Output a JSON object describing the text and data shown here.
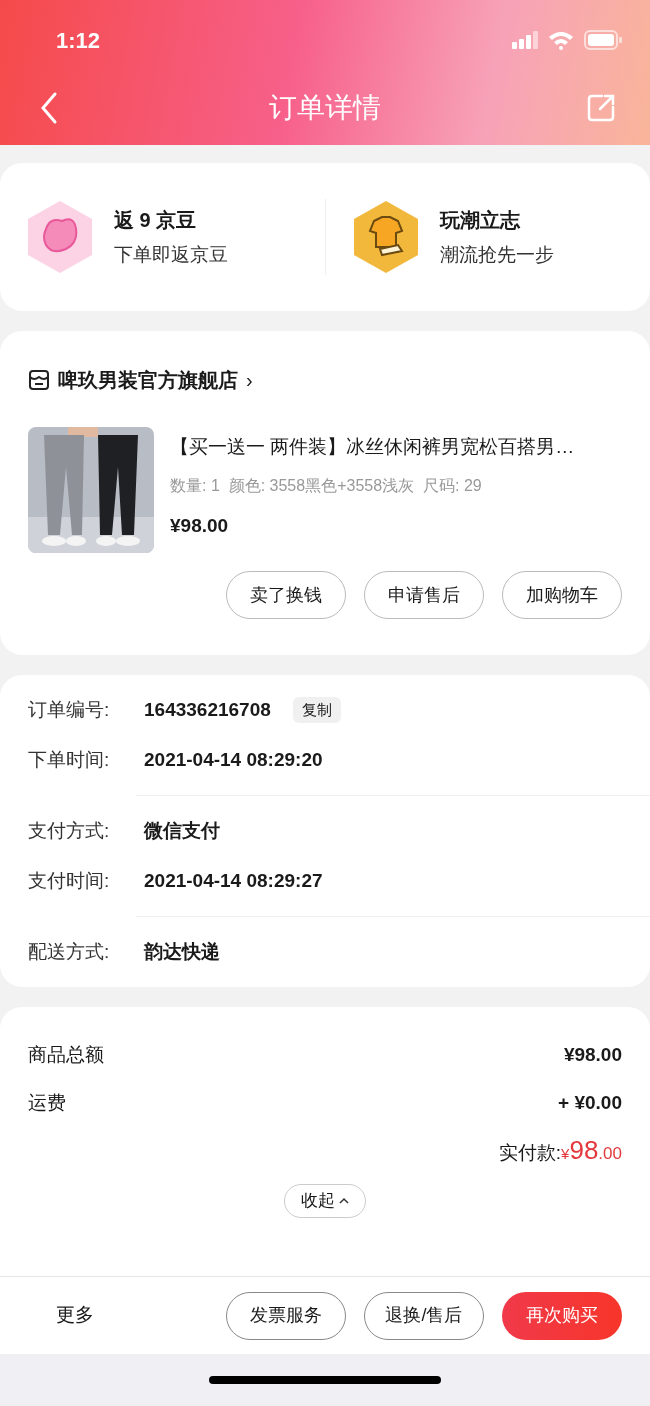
{
  "status_bar": {
    "time": "1:12"
  },
  "header": {
    "title": "订单详情"
  },
  "perks": [
    {
      "kind": "bean",
      "title": "返 9 京豆",
      "subtitle": "下单即返京豆"
    },
    {
      "kind": "trend",
      "title": "玩潮立志",
      "subtitle": "潮流抢先一步"
    }
  ],
  "store": {
    "name": "啤玖男装官方旗舰店",
    "chevron": "›"
  },
  "product": {
    "title": "【买一送一 两件装】冰丝休闲裤男宽松百搭男…",
    "specs": "数量: 1  颜色: 3558黑色+3558浅灰  尺码: 29",
    "price": "¥98.00",
    "actions": [
      "卖了换钱",
      "申请售后",
      "加购物车"
    ]
  },
  "order_info": [
    [
      {
        "label": "订单编号:",
        "value": "164336216708",
        "tag": "复制"
      },
      {
        "label": "下单时间:",
        "value": "2021-04-14 08:29:20"
      }
    ],
    [
      {
        "label": "支付方式:",
        "value": "微信支付"
      },
      {
        "label": "支付时间:",
        "value": "2021-04-14 08:29:27"
      }
    ],
    [
      {
        "label": "配送方式:",
        "value": "韵达快递"
      }
    ]
  ],
  "summary": {
    "rows": [
      {
        "label": "商品总额",
        "value": "¥98.00"
      },
      {
        "label": "运费",
        "value": "+ ¥0.00"
      }
    ],
    "paid_label": "实付款:",
    "paid_currency": "¥",
    "paid_int": "98",
    "paid_dec": ".00",
    "collapse": "收起"
  },
  "bottom_bar": {
    "more": "更多",
    "buttons": [
      {
        "label": "发票服务",
        "primary": false
      },
      {
        "label": "退换/售后",
        "primary": false
      },
      {
        "label": "再次购买",
        "primary": true
      }
    ]
  }
}
